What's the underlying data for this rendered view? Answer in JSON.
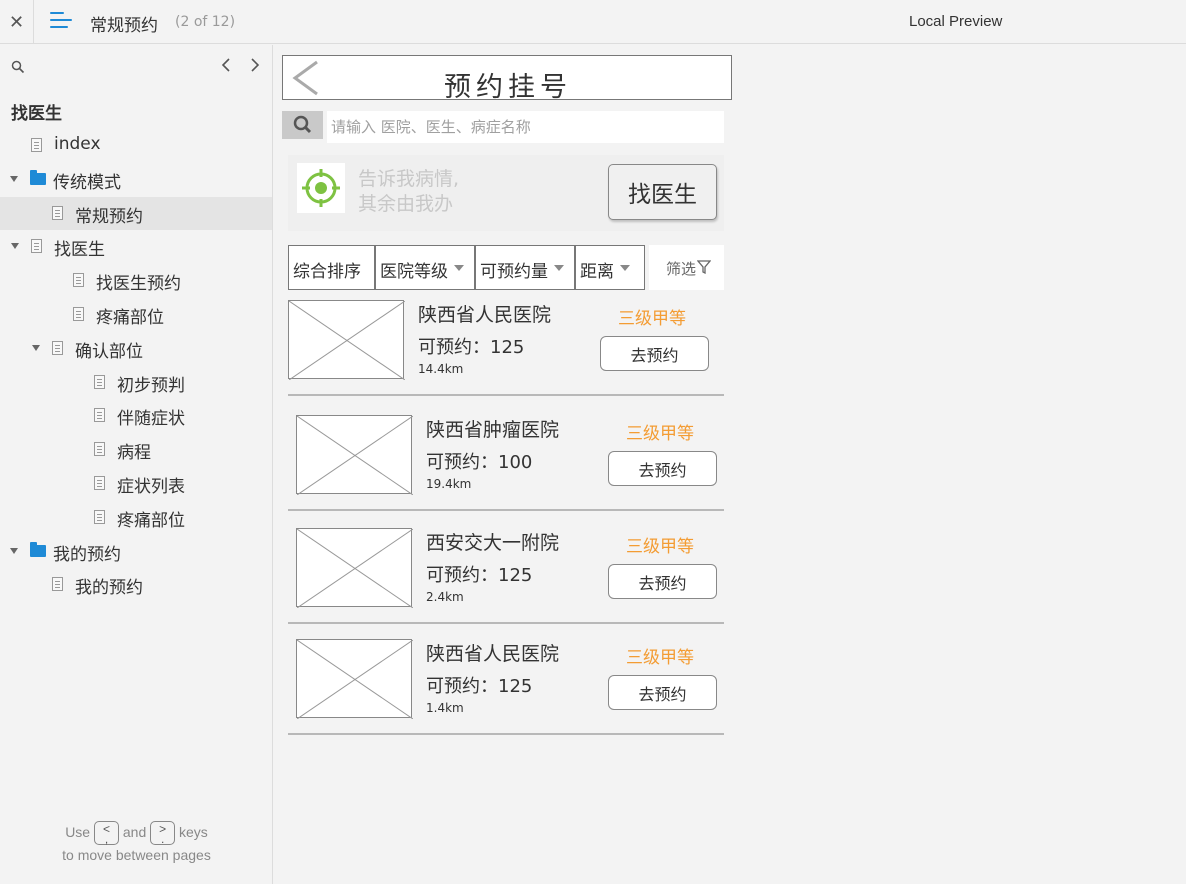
{
  "topbar": {
    "close_glyph": "✕",
    "page_title": "常规预约",
    "page_count": "(2 of 12)",
    "preview_label": "Local Preview"
  },
  "sidebar": {
    "heading": "找医生",
    "nav_prev": "‹",
    "nav_next": "›",
    "items": [
      {
        "label": "index",
        "type": "page",
        "level": 1,
        "expanded": false,
        "selected": false
      },
      {
        "label": "传统模式",
        "type": "folder",
        "level": 0,
        "expanded": true,
        "selected": false
      },
      {
        "label": "常规预约",
        "type": "page",
        "level": 2,
        "expanded": false,
        "selected": true
      },
      {
        "label": "找医生",
        "type": "page",
        "level": 1,
        "expanded": true,
        "selected": false
      },
      {
        "label": "找医生预约",
        "type": "page",
        "level": 3,
        "expanded": false,
        "selected": false
      },
      {
        "label": "疼痛部位",
        "type": "page",
        "level": 3,
        "expanded": false,
        "selected": false
      },
      {
        "label": "确认部位",
        "type": "page",
        "level": 2,
        "expanded": true,
        "selected": false
      },
      {
        "label": "初步预判",
        "type": "page",
        "level": 4,
        "expanded": false,
        "selected": false
      },
      {
        "label": "伴随症状",
        "type": "page",
        "level": 4,
        "expanded": false,
        "selected": false
      },
      {
        "label": "病程",
        "type": "page",
        "level": 4,
        "expanded": false,
        "selected": false
      },
      {
        "label": "症状列表",
        "type": "page",
        "level": 4,
        "expanded": false,
        "selected": false
      },
      {
        "label": "疼痛部位",
        "type": "page",
        "level": 4,
        "expanded": false,
        "selected": false
      },
      {
        "label": "我的预约",
        "type": "folder",
        "level": 0,
        "expanded": true,
        "selected": false
      },
      {
        "label": "我的预约",
        "type": "page",
        "level": 2,
        "expanded": false,
        "selected": false
      }
    ],
    "hint": {
      "use": "Use",
      "key_prev": "<",
      "and": "and",
      "key_next": ">",
      "keys": "keys",
      "line2": "to move between pages"
    }
  },
  "mock": {
    "header_title": "预约挂号",
    "search_placeholder": "请输入 医院、医生、病症名称",
    "promo_line1": "告诉我病情,",
    "promo_line2": "其余由我办",
    "find_doctor_label": "找医生",
    "filters": [
      {
        "label": "综合排序",
        "has_caret": false
      },
      {
        "label": "医院等级",
        "has_caret": true
      },
      {
        "label": "可预约量",
        "has_caret": true
      },
      {
        "label": "距离",
        "has_caret": true
      }
    ],
    "screen_label": "筛选",
    "colors": {
      "grade": "#f39c33",
      "accent": "#1e8ad6",
      "target": "#7ec242"
    },
    "hospitals": [
      {
        "name": "陕西省人民医院",
        "available": "可预约：125",
        "distance": "14.4km",
        "grade": "三级甲等",
        "book_label": "去预约"
      },
      {
        "name": "陕西省肿瘤医院",
        "available": "可预约：100",
        "distance": "19.4km",
        "grade": "三级甲等",
        "book_label": "去预约"
      },
      {
        "name": "西安交大一附院",
        "available": "可预约：125",
        "distance": "2.4km",
        "grade": "三级甲等",
        "book_label": "去预约"
      },
      {
        "name": "陕西省人民医院",
        "available": "可预约：125",
        "distance": "1.4km",
        "grade": "三级甲等",
        "book_label": "去预约"
      }
    ]
  }
}
